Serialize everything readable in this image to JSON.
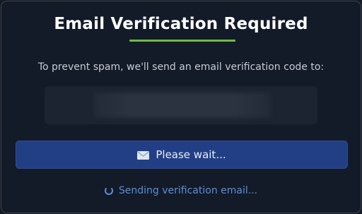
{
  "dialog": {
    "title": "Email Verification Required",
    "subtitle": "To prevent spam, we'll send an email verification code to:",
    "email": "",
    "primary_button": {
      "label": "Please wait...",
      "icon": "envelope-icon"
    },
    "status": {
      "text": "Sending verification email...",
      "icon": "spinner-icon"
    }
  },
  "colors": {
    "background": "#131a28",
    "accent_underline": "#6fbe44",
    "button": "#223f86",
    "status_text": "#5a8fd8"
  }
}
